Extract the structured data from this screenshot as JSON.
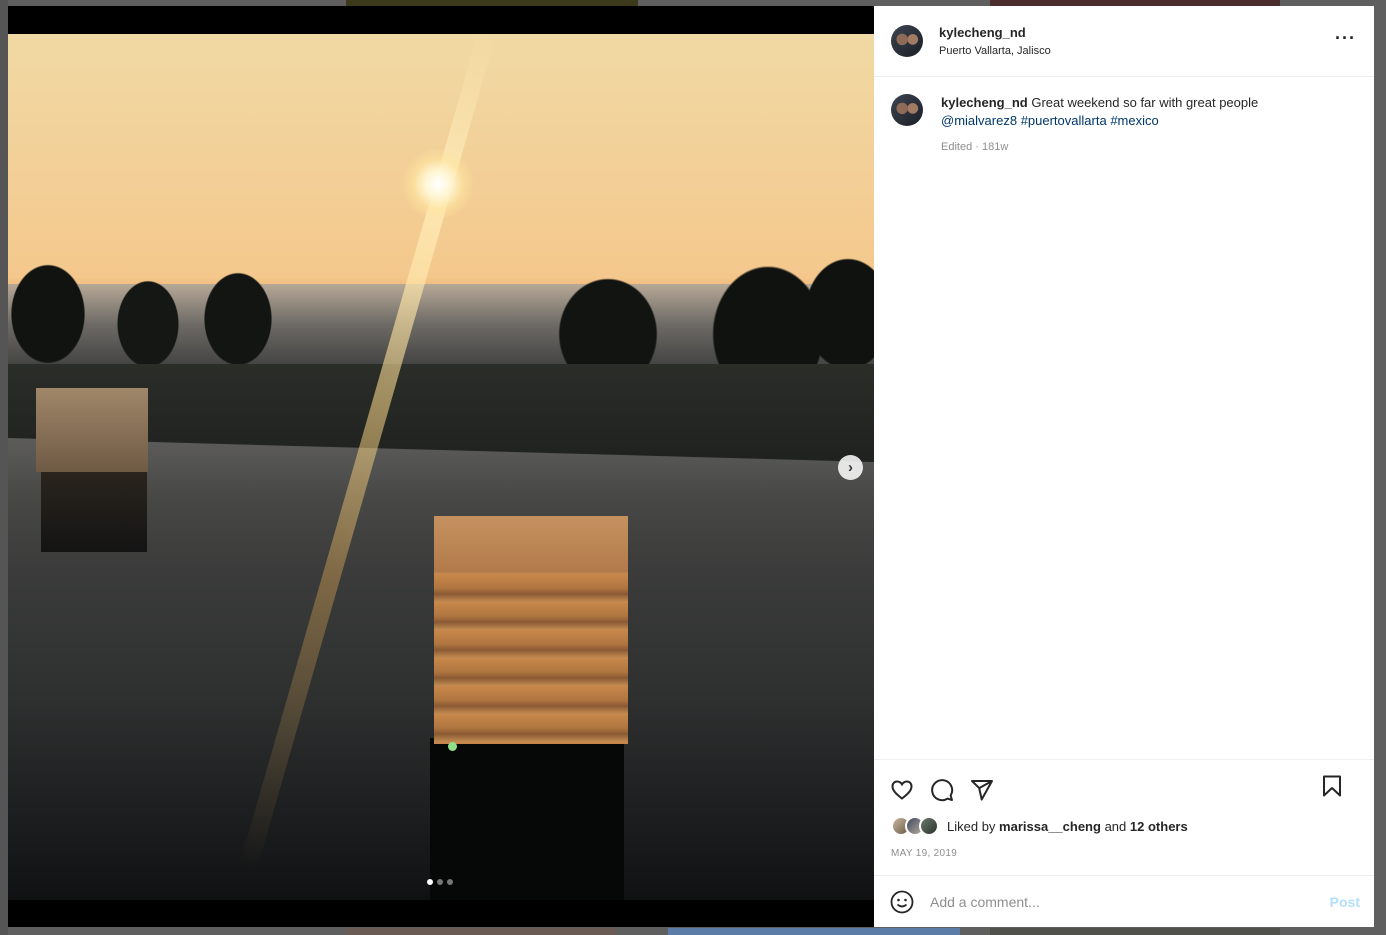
{
  "post": {
    "username": "kylecheng_nd",
    "location": "Puerto Vallarta, Jalisco",
    "caption": {
      "username": "kylecheng_nd",
      "text": "Great weekend so far with great people",
      "mention": "@mialvarez8",
      "hashtags": [
        "#puertovallarta",
        "#mexico"
      ],
      "meta": "Edited · 181w"
    },
    "likes": {
      "prefix": "Liked by",
      "user": "marissa__cheng",
      "conjunction": "and",
      "others": "12 others"
    },
    "date": "MAY 19, 2019",
    "carousel": {
      "total": 3,
      "active": 1
    }
  },
  "comment": {
    "placeholder": "Add a comment...",
    "post_label": "Post"
  },
  "icons": {
    "more": "more-icon",
    "next": "chevron-right-icon",
    "like": "heart-icon",
    "comment": "comment-icon",
    "share": "share-icon",
    "save": "bookmark-icon",
    "emoji": "emoji-icon"
  },
  "colors": {
    "link": "#00376b",
    "muted": "#8e8e8e",
    "post_disabled": "#b2dffc"
  }
}
